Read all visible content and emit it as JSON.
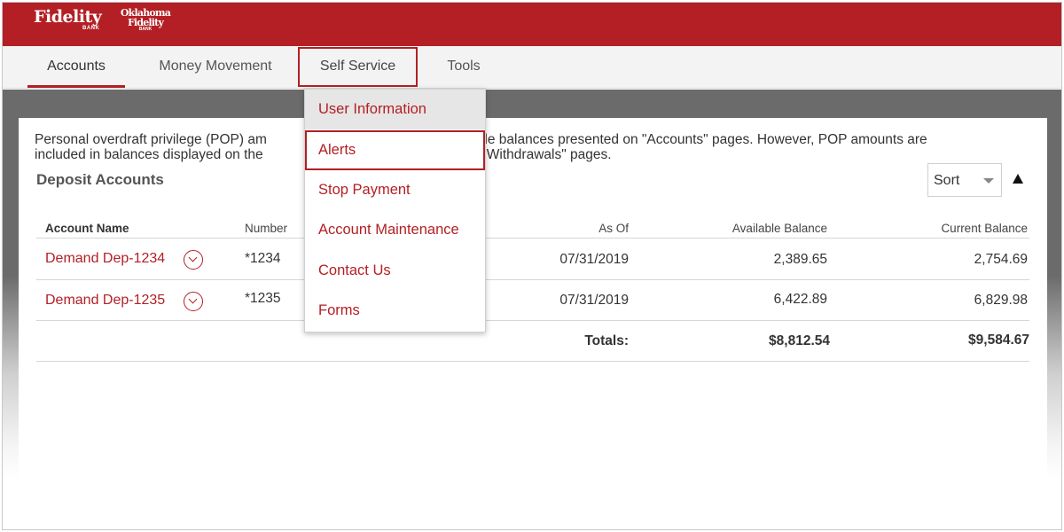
{
  "brand": {
    "logo1": "Fidelity",
    "logo1_sub": "BANK",
    "logo2_line1": "Oklahoma",
    "logo2_line2": "Fidelity",
    "logo2_sub": "BANK",
    "color": "#b31f24"
  },
  "nav": {
    "tabs": [
      {
        "label": "Accounts",
        "active": true
      },
      {
        "label": "Money Movement"
      },
      {
        "label": "Self Service",
        "highlighted": true
      },
      {
        "label": "Tools"
      }
    ]
  },
  "dropdown": {
    "items": [
      {
        "label": "User Information"
      },
      {
        "label": "Alerts",
        "highlighted": true
      },
      {
        "label": "Stop Payment"
      },
      {
        "label": "Account Maintenance"
      },
      {
        "label": "Contact Us"
      },
      {
        "label": "Forms"
      }
    ]
  },
  "main": {
    "notice_visible_1": "Personal overdraft privilege (POP) am",
    "notice_visible_2": "vailable balances presented on \"Accounts\" pages. However, POP amounts are",
    "notice_visible_3": "included in balances displayed on the",
    "notice_visible_4": "nent & Withdrawals\" pages.",
    "section_title": "Deposit Accounts",
    "sort_label": "Sort",
    "columns": {
      "account_name": "Account Name",
      "number": "Number",
      "as_of": "As Of",
      "available": "Available Balance",
      "current": "Current Balance"
    },
    "rows": [
      {
        "name": "Demand Dep-1234",
        "number": "*1234",
        "as_of": "07/31/2019",
        "available": "2,389.65",
        "current": "2,754.69"
      },
      {
        "name": "Demand Dep-1235",
        "number": "*1235",
        "as_of": "07/31/2019",
        "available": "6,422.89",
        "current": "6,829.98"
      }
    ],
    "totals_label": "Totals:",
    "total_available": "$8,812.54",
    "total_current": "$9,584.67"
  }
}
